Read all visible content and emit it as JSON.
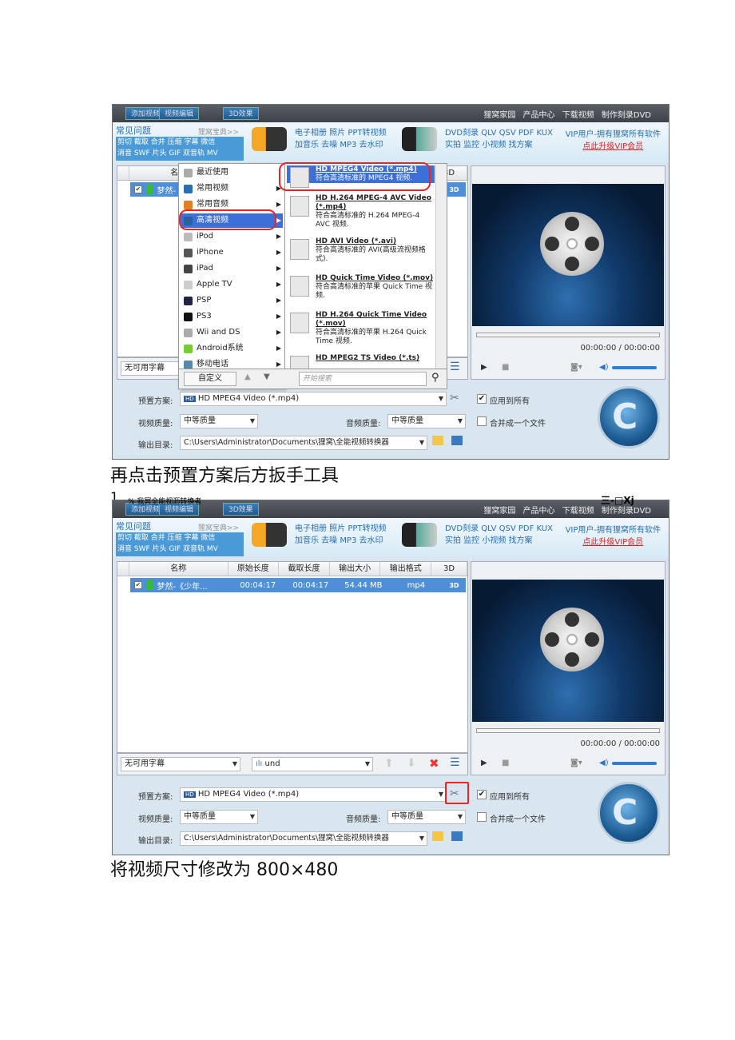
{
  "app": {
    "top_buttons": [
      "添加视频",
      "视频编辑",
      "3D效果"
    ],
    "top_links": [
      "狸窝家园",
      "产品中心",
      "下载视频",
      "制作刻录DVD"
    ],
    "faq_title": "常见问题",
    "faq_more": "狸窝宝典>>",
    "faq_links_1": "剪切 截取 合并 压缩 字幕 微信",
    "faq_links_2": "消音 SWF 片头 GIF 双音轨 MV",
    "ad1_line1": "电子相册 照片 PPT转视频",
    "ad1_line2": "加音乐 去噪 MP3 去水印",
    "ad2_line1": "DVD刻录 QLV QSV PDF KUX",
    "ad2_line2": "实拍 监控 小视频 找方案",
    "vip_line": "VIP用户-拥有狸窝所有软件",
    "vip_link": "点此升级VIP会员",
    "columns": [
      "名称",
      "原始长度",
      "截取长度",
      "输出大小",
      "输出格式",
      "3D"
    ],
    "row": {
      "name": "梦然-《少年...",
      "orig": "00:04:17",
      "cut": "00:04:17",
      "size": "54.44 MB",
      "format": "mp4",
      "3d": "3D"
    },
    "subtitle": "无可用字幕",
    "audio_track": "und",
    "time": "00:00:00 / 00:00:00",
    "preset_label": "预置方案:",
    "preset_value": "HD MPEG4 Video (*.mp4)",
    "apply_all": "应用到所有",
    "video_quality_label": "视频质量:",
    "video_quality": "中等质量",
    "audio_quality_label": "音频质量:",
    "audio_quality": "中等质量",
    "merge": "合并成一个文件",
    "output_label": "输出目录:",
    "output_path": "C:\\Users\\Administrator\\Documents\\狸窝\\全能视频转换器"
  },
  "menu": {
    "items": [
      "最近使用",
      "常用视频",
      "常用音频",
      "高清视频",
      "iPod",
      "iPhone",
      "iPad",
      "Apple TV",
      "PSP",
      "PS3",
      "Wii and DS",
      "Android系统",
      "移动电话"
    ],
    "custom_button": "自定义",
    "search_placeholder": "开始搜索",
    "formats": [
      {
        "title": "HD MPEG4 Video (*.mp4)",
        "desc": "符合高清标准的 MPEG4 视频."
      },
      {
        "title": "HD H.264 MPEG-4 AVC Video (*.mp4)",
        "desc": "符合高清标准的 H.264 MPEG-4 AVC 视频."
      },
      {
        "title": "HD AVI Video (*.avi)",
        "desc": "符合高清标准的 AVI(高级流视频格式)."
      },
      {
        "title": "HD Quick Time Video (*.mov)",
        "desc": "符合高清标准的苹果 Quick Time 视频."
      },
      {
        "title": "HD H.264 Quick Time Video (*.mov)",
        "desc": "符合高清标准的苹果 H.264 Quick Time 视频."
      },
      {
        "title": "HD MPEG2 TS Video (*.ts)",
        "desc": ""
      }
    ]
  },
  "doc": {
    "caption1": "再点击预置方案后方扳手工具",
    "list_marker": "1.",
    "window_title": "% 我冥全能视沥转换者",
    "window_controls": "三-□Xj",
    "caption2": "将视频尺寸修改为 800×480"
  }
}
